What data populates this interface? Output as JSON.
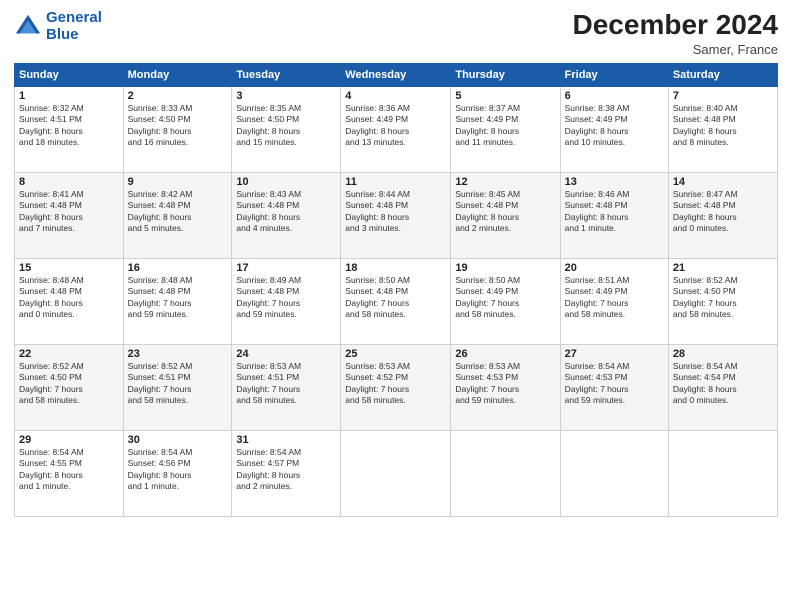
{
  "logo": {
    "line1": "General",
    "line2": "Blue"
  },
  "title": "December 2024",
  "subtitle": "Samer, France",
  "days_of_week": [
    "Sunday",
    "Monday",
    "Tuesday",
    "Wednesday",
    "Thursday",
    "Friday",
    "Saturday"
  ],
  "weeks": [
    [
      {
        "day": "1",
        "info": "Sunrise: 8:32 AM\nSunset: 4:51 PM\nDaylight: 8 hours\nand 18 minutes."
      },
      {
        "day": "2",
        "info": "Sunrise: 8:33 AM\nSunset: 4:50 PM\nDaylight: 8 hours\nand 16 minutes."
      },
      {
        "day": "3",
        "info": "Sunrise: 8:35 AM\nSunset: 4:50 PM\nDaylight: 8 hours\nand 15 minutes."
      },
      {
        "day": "4",
        "info": "Sunrise: 8:36 AM\nSunset: 4:49 PM\nDaylight: 8 hours\nand 13 minutes."
      },
      {
        "day": "5",
        "info": "Sunrise: 8:37 AM\nSunset: 4:49 PM\nDaylight: 8 hours\nand 11 minutes."
      },
      {
        "day": "6",
        "info": "Sunrise: 8:38 AM\nSunset: 4:49 PM\nDaylight: 8 hours\nand 10 minutes."
      },
      {
        "day": "7",
        "info": "Sunrise: 8:40 AM\nSunset: 4:48 PM\nDaylight: 8 hours\nand 8 minutes."
      }
    ],
    [
      {
        "day": "8",
        "info": "Sunrise: 8:41 AM\nSunset: 4:48 PM\nDaylight: 8 hours\nand 7 minutes."
      },
      {
        "day": "9",
        "info": "Sunrise: 8:42 AM\nSunset: 4:48 PM\nDaylight: 8 hours\nand 5 minutes."
      },
      {
        "day": "10",
        "info": "Sunrise: 8:43 AM\nSunset: 4:48 PM\nDaylight: 8 hours\nand 4 minutes."
      },
      {
        "day": "11",
        "info": "Sunrise: 8:44 AM\nSunset: 4:48 PM\nDaylight: 8 hours\nand 3 minutes."
      },
      {
        "day": "12",
        "info": "Sunrise: 8:45 AM\nSunset: 4:48 PM\nDaylight: 8 hours\nand 2 minutes."
      },
      {
        "day": "13",
        "info": "Sunrise: 8:46 AM\nSunset: 4:48 PM\nDaylight: 8 hours\nand 1 minute."
      },
      {
        "day": "14",
        "info": "Sunrise: 8:47 AM\nSunset: 4:48 PM\nDaylight: 8 hours\nand 0 minutes."
      }
    ],
    [
      {
        "day": "15",
        "info": "Sunrise: 8:48 AM\nSunset: 4:48 PM\nDaylight: 8 hours\nand 0 minutes."
      },
      {
        "day": "16",
        "info": "Sunrise: 8:48 AM\nSunset: 4:48 PM\nDaylight: 7 hours\nand 59 minutes."
      },
      {
        "day": "17",
        "info": "Sunrise: 8:49 AM\nSunset: 4:48 PM\nDaylight: 7 hours\nand 59 minutes."
      },
      {
        "day": "18",
        "info": "Sunrise: 8:50 AM\nSunset: 4:48 PM\nDaylight: 7 hours\nand 58 minutes."
      },
      {
        "day": "19",
        "info": "Sunrise: 8:50 AM\nSunset: 4:49 PM\nDaylight: 7 hours\nand 58 minutes."
      },
      {
        "day": "20",
        "info": "Sunrise: 8:51 AM\nSunset: 4:49 PM\nDaylight: 7 hours\nand 58 minutes."
      },
      {
        "day": "21",
        "info": "Sunrise: 8:52 AM\nSunset: 4:50 PM\nDaylight: 7 hours\nand 58 minutes."
      }
    ],
    [
      {
        "day": "22",
        "info": "Sunrise: 8:52 AM\nSunset: 4:50 PM\nDaylight: 7 hours\nand 58 minutes."
      },
      {
        "day": "23",
        "info": "Sunrise: 8:52 AM\nSunset: 4:51 PM\nDaylight: 7 hours\nand 58 minutes."
      },
      {
        "day": "24",
        "info": "Sunrise: 8:53 AM\nSunset: 4:51 PM\nDaylight: 7 hours\nand 58 minutes."
      },
      {
        "day": "25",
        "info": "Sunrise: 8:53 AM\nSunset: 4:52 PM\nDaylight: 7 hours\nand 58 minutes."
      },
      {
        "day": "26",
        "info": "Sunrise: 8:53 AM\nSunset: 4:53 PM\nDaylight: 7 hours\nand 59 minutes."
      },
      {
        "day": "27",
        "info": "Sunrise: 8:54 AM\nSunset: 4:53 PM\nDaylight: 7 hours\nand 59 minutes."
      },
      {
        "day": "28",
        "info": "Sunrise: 8:54 AM\nSunset: 4:54 PM\nDaylight: 8 hours\nand 0 minutes."
      }
    ],
    [
      {
        "day": "29",
        "info": "Sunrise: 8:54 AM\nSunset: 4:55 PM\nDaylight: 8 hours\nand 1 minute."
      },
      {
        "day": "30",
        "info": "Sunrise: 8:54 AM\nSunset: 4:56 PM\nDaylight: 8 hours\nand 1 minute."
      },
      {
        "day": "31",
        "info": "Sunrise: 8:54 AM\nSunset: 4:57 PM\nDaylight: 8 hours\nand 2 minutes."
      },
      null,
      null,
      null,
      null
    ]
  ]
}
